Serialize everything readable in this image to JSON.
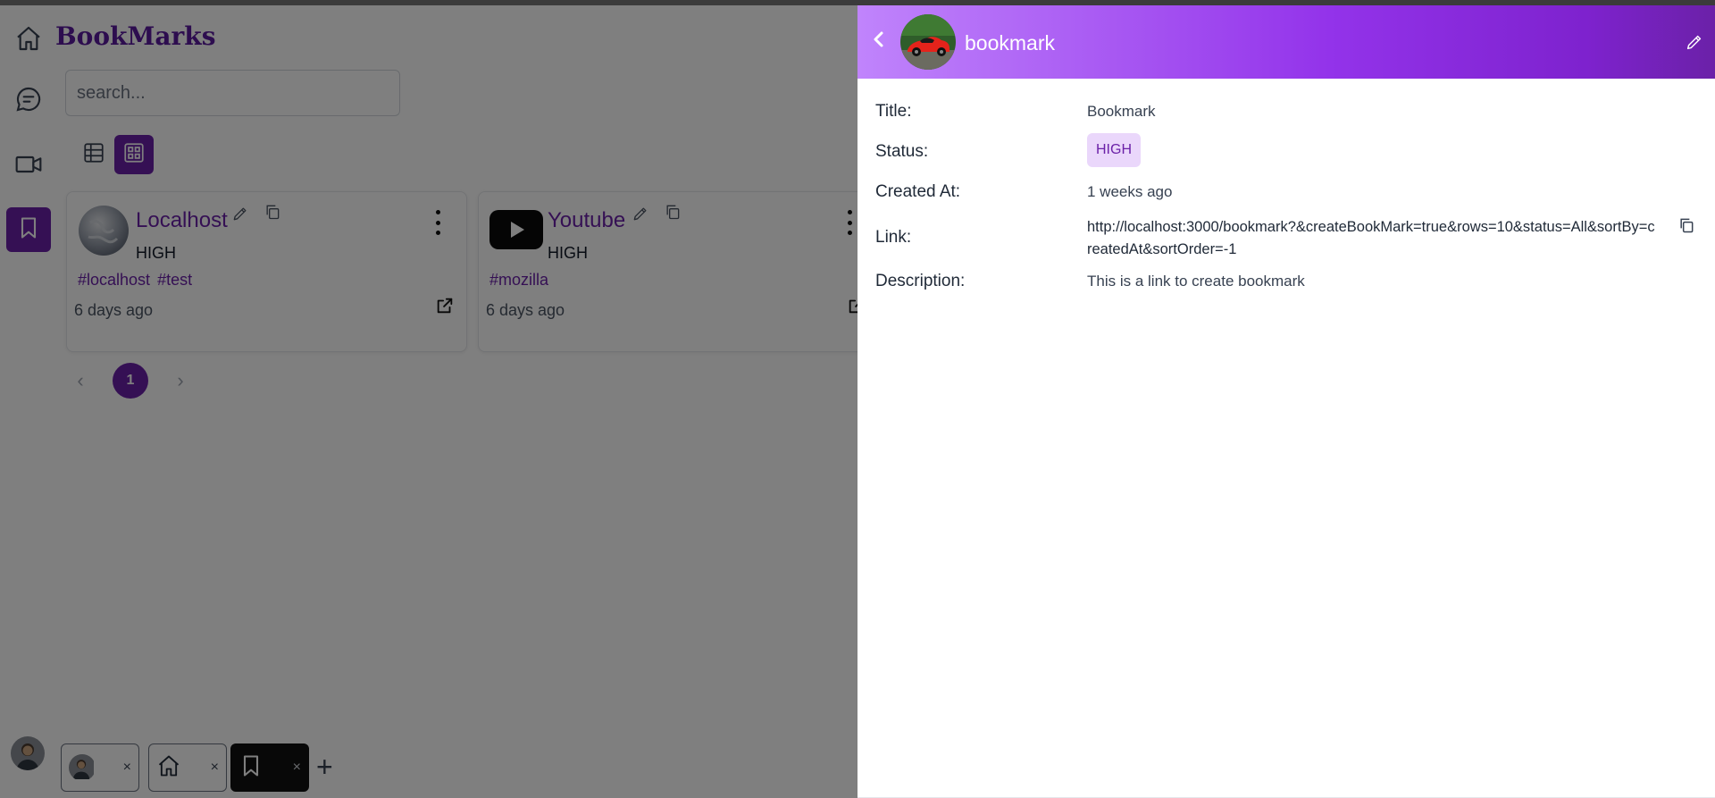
{
  "app": {
    "brand": "BookMarks"
  },
  "rail": {
    "items": [
      {
        "name": "home",
        "icon": "home-icon"
      },
      {
        "name": "chat",
        "icon": "chat-icon"
      },
      {
        "name": "video",
        "icon": "video-icon"
      },
      {
        "name": "bookmarks",
        "icon": "bookmark-icon",
        "active": true
      }
    ]
  },
  "search": {
    "placeholder": "search..."
  },
  "view_toggle": {
    "active": "grid"
  },
  "cards": [
    {
      "title": "Localhost",
      "status": "HIGH",
      "tags": [
        "#localhost",
        "#test"
      ],
      "time": "6 days ago",
      "icon": "globe-icon"
    },
    {
      "title": "Youtube",
      "status": "HIGH",
      "tags": [
        "#mozilla"
      ],
      "time": "6 days ago",
      "icon": "youtube-icon"
    }
  ],
  "pagination": {
    "current": "1",
    "prev": "‹",
    "next": "›"
  },
  "dock": {
    "tabs": [
      {
        "icon": "avatar-icon",
        "close": "×"
      },
      {
        "icon": "home-icon",
        "close": "×"
      },
      {
        "icon": "bookmark-icon",
        "close": "×",
        "active": true
      }
    ],
    "add": "+"
  },
  "drawer": {
    "title": "bookmark",
    "fields": {
      "title_label": "Title:",
      "title_value": "Bookmark",
      "status_label": "Status:",
      "status_value": "HIGH",
      "created_label": "Created At:",
      "created_value": "1 weeks ago",
      "link_label": "Link:",
      "link_value": "http://localhost:3000/bookmark?&createBookMark=true&rows=10&status=All&sortBy=createdAt&sortOrder=-1",
      "description_label": "Description:",
      "description_value": "This is a link to create bookmark"
    }
  },
  "colors": {
    "accent": "#6b21a8",
    "badge_bg": "#ead7fb",
    "header_gradient_start": "#c084fc",
    "header_gradient_end": "#6b21a8"
  }
}
